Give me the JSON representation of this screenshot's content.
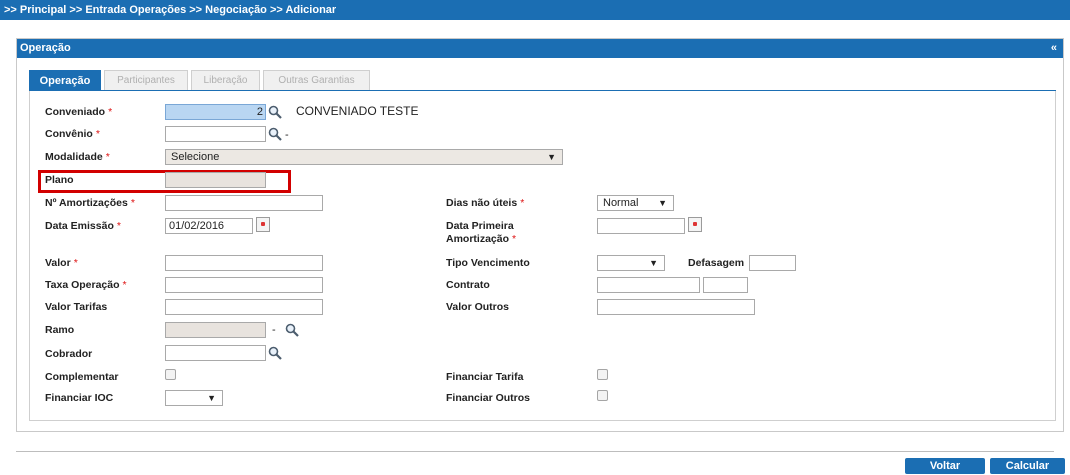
{
  "breadcrumb": ">> Principal >> Entrada Operações  >> Negociação  >> Adicionar",
  "panel": {
    "title": "Operação",
    "collapse": "«"
  },
  "tabs": [
    {
      "label": "Operação",
      "active": true
    },
    {
      "label": "Participantes",
      "active": false
    },
    {
      "label": "Liberação",
      "active": false
    },
    {
      "label": "Outras Garantias",
      "active": false
    }
  ],
  "required_marker": "*",
  "fields": {
    "conveniado": {
      "label": "Conveniado",
      "value": "2",
      "name_text": "CONVENIADO TESTE"
    },
    "convenio": {
      "label": "Convênio",
      "value": "",
      "dash": "-"
    },
    "modalidade": {
      "label": "Modalidade",
      "value": "Selecione"
    },
    "plano": {
      "label": "Plano",
      "value": ""
    },
    "n_amortizacoes": {
      "label": "Nº Amortizações",
      "value": ""
    },
    "data_emissao": {
      "label": "Data Emissão",
      "value": "01/02/2016"
    },
    "valor": {
      "label": "Valor",
      "value": ""
    },
    "taxa_operacao": {
      "label": "Taxa Operação",
      "value": ""
    },
    "valor_tarifas": {
      "label": "Valor Tarifas",
      "value": ""
    },
    "ramo": {
      "label": "Ramo",
      "value": "",
      "dash": "-"
    },
    "cobrador": {
      "label": "Cobrador",
      "value": ""
    },
    "complementar": {
      "label": "Complementar",
      "checked": false
    },
    "financiar_ioc": {
      "label": "Financiar IOC",
      "value": ""
    },
    "dias_nao_uteis": {
      "label": "Dias não úteis",
      "value": "Normal"
    },
    "data_primeira_amortizacao": {
      "label_line1": "Data Primeira",
      "label_line2": "Amortização",
      "value": ""
    },
    "tipo_vencimento": {
      "label": "Tipo Vencimento",
      "value": ""
    },
    "defasagem": {
      "label": "Defasagem",
      "value": ""
    },
    "contrato": {
      "label": "Contrato",
      "value1": "",
      "value2": ""
    },
    "valor_outros": {
      "label": "Valor Outros",
      "value": ""
    },
    "financiar_tarifa": {
      "label": "Financiar Tarifa",
      "checked": false
    },
    "financiar_outros": {
      "label": "Financiar Outros",
      "checked": false
    }
  },
  "buttons": {
    "voltar": "Voltar",
    "calcular": "Calcular"
  },
  "colors": {
    "primary": "#1b6eb3",
    "required": "#d11111",
    "highlight_box": "#d20000"
  }
}
